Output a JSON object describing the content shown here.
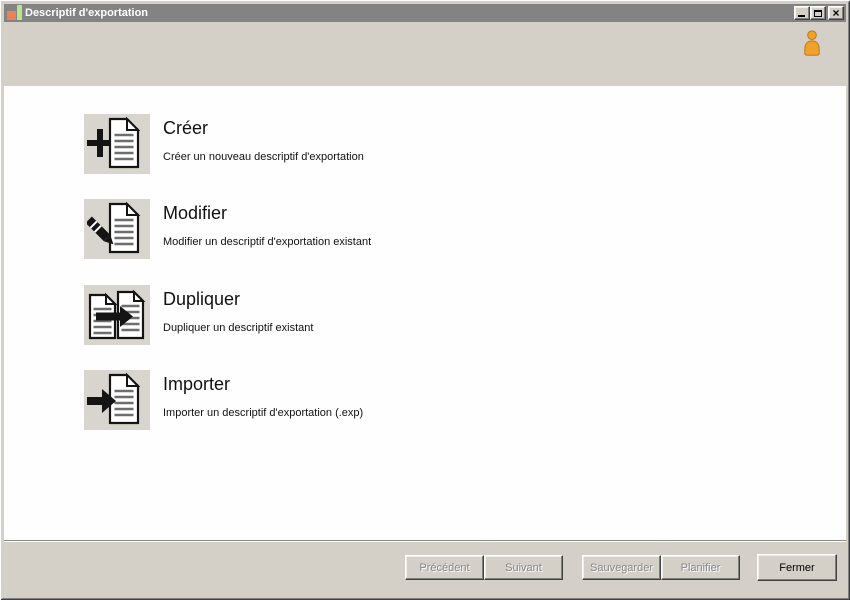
{
  "window": {
    "title": "Descriptif d'exportation",
    "logo_icon": "bar-chart-logo-icon",
    "controls": {
      "minimize": "minimize-icon",
      "maximize": "maximize-icon",
      "close": "close-icon"
    }
  },
  "header": {
    "user_icon": "person-icon"
  },
  "options": [
    {
      "title": "Créer",
      "description": "Créer un nouveau descriptif d'exportation",
      "icon": "document-plus-icon"
    },
    {
      "title": "Modifier",
      "description": "Modifier un descriptif d'exportation existant",
      "icon": "document-pencil-icon"
    },
    {
      "title": "Dupliquer",
      "description": "Dupliquer un descriptif existant",
      "icon": "document-duplicate-icon"
    },
    {
      "title": "Importer",
      "description": "Importer un descriptif d'exportation (.exp)",
      "icon": "document-import-icon"
    }
  ],
  "footer": {
    "buttons": [
      {
        "label": "Précédent",
        "enabled": false
      },
      {
        "label": "Suivant",
        "enabled": false
      },
      {
        "label": "Sauvegarder",
        "enabled": false
      },
      {
        "label": "Planifier",
        "enabled": false
      },
      {
        "label": "Fermer",
        "enabled": true
      }
    ]
  },
  "icons": {
    "close_glyph": "×"
  },
  "colors": {
    "titlebar": "#838383",
    "chrome": "#d4d0c8",
    "content_bg": "#fefefe",
    "tile_bg": "#d8d5ce",
    "logo_orange": "#ee8055",
    "logo_green": "#b5e687",
    "person_orange": "#f0a12c",
    "person_outline": "#b97c14",
    "disabled_text": "#868686"
  }
}
